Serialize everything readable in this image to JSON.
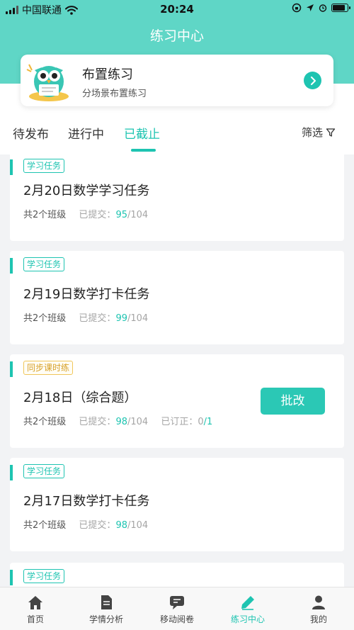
{
  "status_bar": {
    "carrier": "中国联通",
    "time": "20:24"
  },
  "nav": {
    "title": "练习中心"
  },
  "promo": {
    "title": "布置练习",
    "subtitle": "分场景布置练习"
  },
  "tabs": [
    {
      "label": "待发布"
    },
    {
      "label": "进行中"
    },
    {
      "label": "已截止",
      "active": true
    }
  ],
  "filter": {
    "label": "筛选"
  },
  "cards": [
    {
      "tag": "学习任务",
      "title": "2月20日数学学习任务",
      "classes": "共2个班级",
      "submitted_label": "已提交：",
      "submitted": "95",
      "total": "/104"
    },
    {
      "tag": "学习任务",
      "title": "2月19日数学打卡任务",
      "classes": "共2个班级",
      "submitted_label": "已提交：",
      "submitted": "99",
      "total": "/104"
    },
    {
      "tag": "同步课时练",
      "title": "2月18日（综合题）",
      "classes": "共2个班级",
      "submitted_label": "已提交：",
      "submitted": "98",
      "total": "/104",
      "corrected_label": "已订正：",
      "corrected_done": "0",
      "corrected_total": "/1",
      "button": "批改"
    },
    {
      "tag": "学习任务",
      "title": "2月17日数学打卡任务",
      "classes": "共2个班级",
      "submitted_label": "已提交：",
      "submitted": "98",
      "total": "/104"
    },
    {
      "tag": "学习任务"
    }
  ],
  "bottom_nav": [
    {
      "label": "首页",
      "icon": "home-icon"
    },
    {
      "label": "学情分析",
      "icon": "document-icon"
    },
    {
      "label": "移动阅卷",
      "icon": "chat-icon"
    },
    {
      "label": "练习中心",
      "icon": "pencil-icon",
      "active": true
    },
    {
      "label": "我的",
      "icon": "person-icon"
    }
  ],
  "colors": {
    "header": "#5fd6c6",
    "accent": "#1ec4b1",
    "tag_yellow": "#f0c65a",
    "background": "#f2f3f5"
  }
}
